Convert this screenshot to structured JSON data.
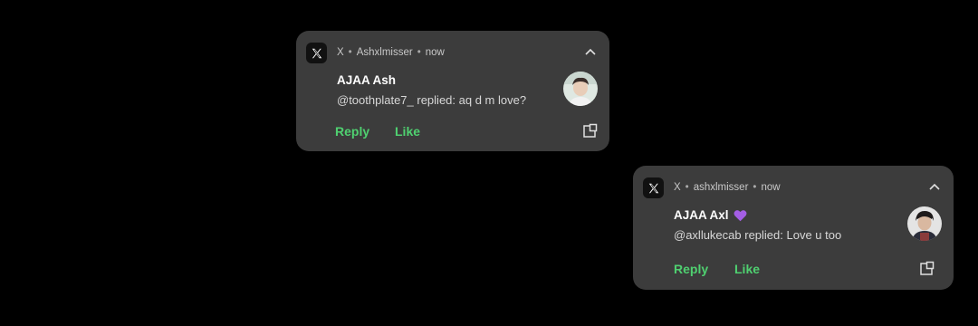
{
  "notifications": [
    {
      "app_name": "X",
      "account": "Ashxlmisser",
      "time": "now",
      "title": "AJAA Ash",
      "title_emoji": "",
      "message": "@toothplate7_ replied: aq d m love?",
      "actions": {
        "reply": "Reply",
        "like": "Like"
      },
      "icons": {
        "app": "x-logo-icon",
        "expand": "chevron-up-icon",
        "open": "open-external-icon"
      }
    },
    {
      "app_name": "X",
      "account": "ashxlmisser",
      "time": "now",
      "title": "AJAA Axl",
      "title_emoji": "purple-heart",
      "message": "@axllukecab replied: Love u too",
      "actions": {
        "reply": "Reply",
        "like": "Like"
      },
      "icons": {
        "app": "x-logo-icon",
        "expand": "chevron-up-icon",
        "open": "open-external-icon"
      }
    }
  ],
  "colors": {
    "background": "#000000",
    "card": "#3c3c3c",
    "action": "#4fd070",
    "heart": "#a45ee5"
  }
}
